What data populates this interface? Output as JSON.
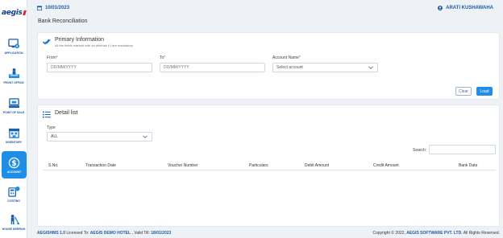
{
  "app": {
    "logo_text": "aegis"
  },
  "colors": {
    "accent": "#1f8ee6",
    "brand": "#1b5fa8",
    "required": "#e2252b"
  },
  "sidebar": {
    "items": [
      {
        "label": "APPLICATION",
        "icon": "application-icon",
        "active": false
      },
      {
        "label": "FRONT OFFICE",
        "icon": "front-office-icon",
        "active": false
      },
      {
        "label": "POINT OF SALE",
        "icon": "point-of-sale-icon",
        "active": false
      },
      {
        "label": "INVENTORY",
        "icon": "inventory-icon",
        "active": false
      },
      {
        "label": "ACCOUNT",
        "icon": "account-icon",
        "active": true
      },
      {
        "label": "COSTING",
        "icon": "costing-icon",
        "active": false
      },
      {
        "label": "HOUSE KEEPING",
        "icon": "house-keeping-icon",
        "active": false
      }
    ]
  },
  "header": {
    "date": "10/01/2023",
    "user": "ARATI KUSHAWAHA"
  },
  "page": {
    "title": "Bank Reconciliation"
  },
  "primary": {
    "title": "Primary Information",
    "subtitle": "All the fields marked with an asterisk (*) are mandatory",
    "from_label": "From",
    "from_placeholder": "DD/MM/YYYY",
    "to_label": "To",
    "to_placeholder": "DD/MM/YYYY",
    "account_label": "Account Name",
    "account_value": "Select account",
    "required_mark": "*",
    "clear_label": "Clear",
    "load_label": "Load"
  },
  "detail": {
    "title": "Detail list",
    "type_label": "Type",
    "type_value": "ALL",
    "search_label": "Search:",
    "columns": [
      "S.No.",
      "Transaction Date",
      "Voucher Number",
      "Particulars",
      "Debit Amount",
      "Credit Amount",
      "Bank Date"
    ]
  },
  "footer": {
    "product": "AEGISHMS 1.0",
    "licensed_to_label": " Licensed To: ",
    "licensee": "AEGIS DEMO HOTEL",
    "valid_till_label": " , Valid Till: ",
    "valid_till": "18/01/2023",
    "copyright_prefix": "Copyright © 2022, ",
    "company": "AEGIS SOFTWARE PVT. LTD.",
    "rights": " All Rights Reserved."
  }
}
